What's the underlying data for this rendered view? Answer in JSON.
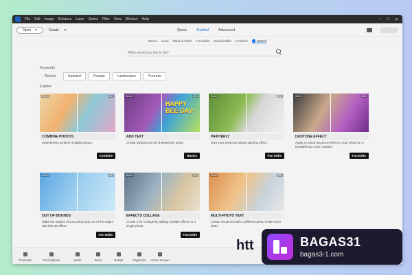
{
  "menu": [
    "File",
    "Edit",
    "Image",
    "Enhance",
    "Layer",
    "Select",
    "Filter",
    "View",
    "Window",
    "Help"
  ],
  "window_controls": [
    "–",
    "□",
    "✕"
  ],
  "toolbar": {
    "open_label": "Open",
    "create_label": "Create"
  },
  "modes": {
    "quick": "Quick",
    "guided": "Guided",
    "advanced": "Advanced"
  },
  "subtabs": [
    "Basics",
    "Color",
    "Black & White",
    "Fun Edits",
    "Special Edits",
    "Combine",
    "Search"
  ],
  "search": {
    "placeholder": "What would you like to do?"
  },
  "keywords": {
    "label": "Keywords",
    "items": [
      "Recent",
      "Updated",
      "Popular",
      "Landscapes",
      "Portraits"
    ]
  },
  "explore_label": "Explore",
  "cards": [
    {
      "before": "Before",
      "after": "After",
      "title": "COMBINE PHOTOS",
      "desc": "Seamlessly combine multiple photos.",
      "tag": "Combine"
    },
    {
      "before": "Before",
      "after": "After",
      "title": "ADD TEXT",
      "desc": "Create stylized text for shareworthy posts.",
      "tag": "Basics",
      "overlay": "HAPPY BEE-DAY!"
    },
    {
      "before": "Before",
      "after": "After",
      "title": "PAINTERLY",
      "desc": "Give your photo an artistic painting effect.",
      "tag": "Fun Edits"
    },
    {
      "before": "Before",
      "after": "After",
      "title": "DUOTONE EFFECT",
      "desc": "Apply a custom Duotone Effect to your photo for a beautiful two-color creation.",
      "tag": "Fun Edits"
    },
    {
      "before": "Before",
      "after": "After",
      "title": "OUT OF BOUNDS",
      "desc": "Make the subject of your photo pop out of the edges with this 3D effect.",
      "tag": "Fun Edits"
    },
    {
      "before": "Before",
      "after": "After",
      "title": "EFFECTS COLLAGE",
      "desc": "Create a fun collage by adding multiple effects to a single photo.",
      "tag": "Fun Edits"
    },
    {
      "before": "Before",
      "after": "After",
      "title": "MULTI-PHOTO TEXT",
      "desc": "Create visual text with a different photo inside each letter.",
      "tag": ""
    }
  ],
  "bottombar": [
    "Photo Bin",
    "Tool Options",
    "Undo",
    "Redo",
    "Rotate",
    "Organizer",
    "Home Screen"
  ],
  "watermark": {
    "partial": "htt",
    "title": "BAGAS31",
    "sub": "bagas3-1.com"
  },
  "colors": {
    "accent": "#1473e6",
    "menubar": "#2b2b2b",
    "tag_bg": "#111111"
  }
}
